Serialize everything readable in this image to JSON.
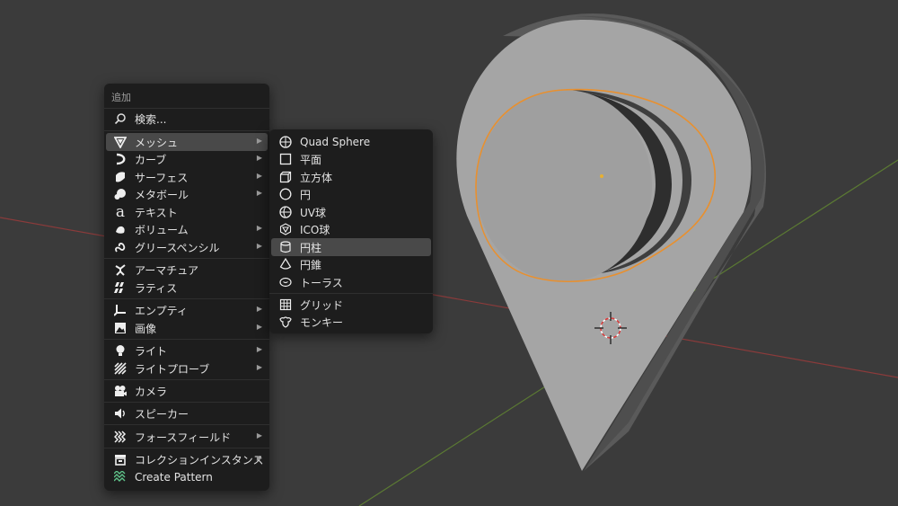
{
  "add_menu": {
    "title": "追加",
    "search": {
      "label": "検索...",
      "icon": "search-icon"
    },
    "items": [
      {
        "label": "メッシュ",
        "icon": "mesh-icon",
        "has_submenu": true,
        "highlighted": true
      },
      {
        "label": "カーブ",
        "icon": "curve-icon",
        "has_submenu": true
      },
      {
        "label": "サーフェス",
        "icon": "surface-icon",
        "has_submenu": true
      },
      {
        "label": "メタボール",
        "icon": "metaball-icon",
        "has_submenu": true
      },
      {
        "label": "テキスト",
        "icon": "text-icon",
        "has_submenu": false
      },
      {
        "label": "ボリューム",
        "icon": "volume-icon",
        "has_submenu": true
      },
      {
        "label": "グリースペンシル",
        "icon": "grease-pencil-icon",
        "has_submenu": true
      },
      {
        "label": "アーマチュア",
        "icon": "armature-icon",
        "has_submenu": false
      },
      {
        "label": "ラティス",
        "icon": "lattice-icon",
        "has_submenu": false
      },
      {
        "label": "エンプティ",
        "icon": "empty-icon",
        "has_submenu": true
      },
      {
        "label": "画像",
        "icon": "image-icon",
        "has_submenu": true
      },
      {
        "label": "ライト",
        "icon": "light-icon",
        "has_submenu": true
      },
      {
        "label": "ライトプローブ",
        "icon": "light-probe-icon",
        "has_submenu": true
      },
      {
        "label": "カメラ",
        "icon": "camera-icon",
        "has_submenu": false
      },
      {
        "label": "スピーカー",
        "icon": "speaker-icon",
        "has_submenu": false
      },
      {
        "label": "フォースフィールド",
        "icon": "force-field-icon",
        "has_submenu": true
      },
      {
        "label": "コレクションインスタンス",
        "icon": "collection-instance-icon",
        "has_submenu": true
      },
      {
        "label": "Create Pattern",
        "icon": "create-pattern-icon",
        "has_submenu": false
      }
    ]
  },
  "mesh_submenu": {
    "items": [
      {
        "label": "Quad Sphere",
        "icon": "quad-sphere-icon"
      },
      {
        "label": "平面",
        "icon": "plane-icon"
      },
      {
        "label": "立方体",
        "icon": "cube-icon"
      },
      {
        "label": "円",
        "icon": "circle-icon"
      },
      {
        "label": "UV球",
        "icon": "uv-sphere-icon"
      },
      {
        "label": "ICO球",
        "icon": "ico-sphere-icon"
      },
      {
        "label": "円柱",
        "icon": "cylinder-icon",
        "highlighted": true
      },
      {
        "label": "円錐",
        "icon": "cone-icon"
      },
      {
        "label": "トーラス",
        "icon": "torus-icon"
      },
      {
        "label": "グリッド",
        "icon": "grid-icon"
      },
      {
        "label": "モンキー",
        "icon": "monkey-icon"
      }
    ]
  },
  "colors": {
    "viewport_bg": "#3b3b3b",
    "menu_bg": "#1d1d1d",
    "highlight": "#494949",
    "selection_outline": "#e8902f",
    "x_axis": "#8c3a3a",
    "y_axis": "#5d7a33",
    "create_pattern_accent": "#5fc38a"
  }
}
